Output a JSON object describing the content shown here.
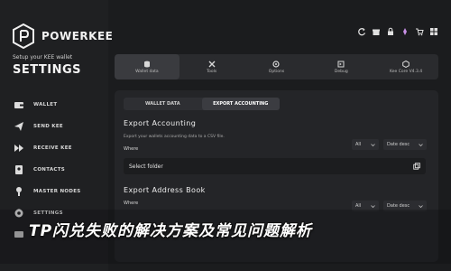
{
  "brand": {
    "name": "POWERKEE",
    "icon": "powerkee-logo-icon"
  },
  "sidebar": {
    "subtitle": "Setup your KEE wallet",
    "title": "SETTINGS",
    "items": [
      {
        "label": "WALLET",
        "icon": "wallet-icon"
      },
      {
        "label": "SEND KEE",
        "icon": "send-icon"
      },
      {
        "label": "RECEIVE KEE",
        "icon": "receive-icon"
      },
      {
        "label": "CONTACTS",
        "icon": "contacts-icon"
      },
      {
        "label": "MASTER NODES",
        "icon": "master-nodes-icon"
      },
      {
        "label": "SETTINGS",
        "icon": "settings-icon",
        "active": true
      },
      {
        "label": "",
        "icon": "message-icon"
      }
    ]
  },
  "topbar": {
    "icons": [
      "sync-icon",
      "gift-icon",
      "lock-icon",
      "unlock-icon",
      "cart-icon",
      "grid-icon"
    ]
  },
  "tabs": [
    {
      "label": "Wallet data",
      "icon": "database-icon",
      "active": true
    },
    {
      "label": "Tools",
      "icon": "tools-icon"
    },
    {
      "label": "Options",
      "icon": "options-icon"
    },
    {
      "label": "Debug",
      "icon": "debug-icon"
    },
    {
      "label": "Kee Core V4.3.4",
      "icon": "core-icon"
    }
  ],
  "subtabs": [
    {
      "label": "WALLET DATA",
      "active": false
    },
    {
      "label": "EXPORT ACCOUNTING",
      "active": true
    }
  ],
  "export_accounting": {
    "title": "Export Accounting",
    "desc": "Export your wallets accounting data to a CSV file.",
    "where_label": "Where",
    "filter_value": "All",
    "sort_value": "Date desc",
    "folder_value": "Select folder"
  },
  "export_address_book": {
    "title": "Export Address Book",
    "where_label": "Where",
    "filter_value": "All",
    "sort_value": "Date desc"
  },
  "overlay": {
    "text": "TP闪兑失败的解决方案及常见问题解析"
  },
  "colors": {
    "background": "#1b1c1e",
    "panel": "#242528",
    "accent": "#ffffff"
  }
}
